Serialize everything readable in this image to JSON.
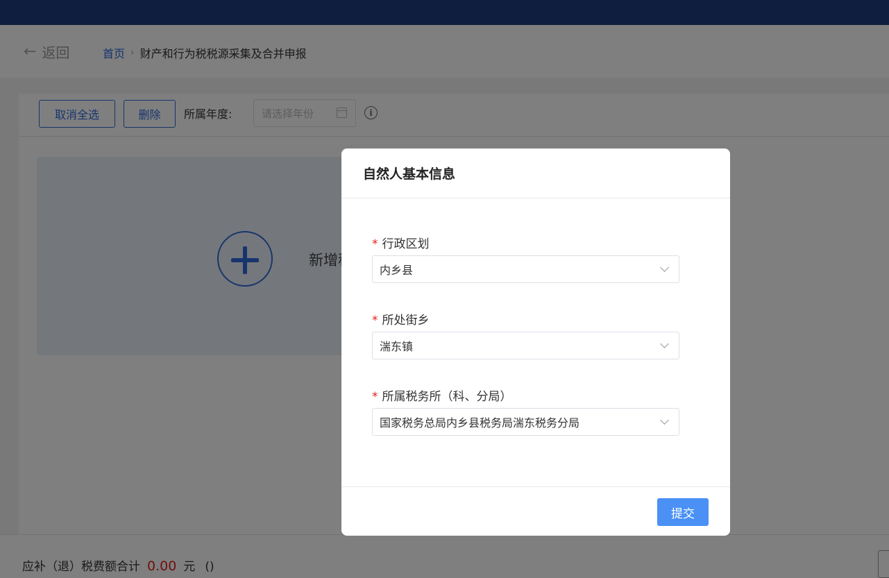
{
  "header": {
    "back_label": "返回",
    "breadcrumb_home": "首页",
    "breadcrumb_separator": "›",
    "breadcrumb_current": "财产和行为税税源采集及合并申报"
  },
  "toolbar": {
    "deselect_all_label": "取消全选",
    "delete_label": "删除",
    "year_label": "所属年度:",
    "year_placeholder": "请选择年份",
    "info_glyph": "i"
  },
  "add_card": {
    "label": "新增税"
  },
  "footer": {
    "total_label": "应补（退）税费额合计",
    "total_amount": "0.00",
    "currency": "元",
    "paren": "()"
  },
  "modal": {
    "title": "自然人基本信息",
    "required_mark": "*",
    "fields": [
      {
        "label": "行政区划",
        "value": "内乡县"
      },
      {
        "label": "所处街乡",
        "value": "湍东镇"
      },
      {
        "label": "所属税务所（科、分局）",
        "value": "国家税务总局内乡县税务局湍东税务分局"
      }
    ],
    "submit_label": "提交"
  },
  "colors": {
    "topbar": "#1e3c7c",
    "primary": "#2f6bd8",
    "submit": "#4a90f5",
    "required": "#e02020"
  }
}
